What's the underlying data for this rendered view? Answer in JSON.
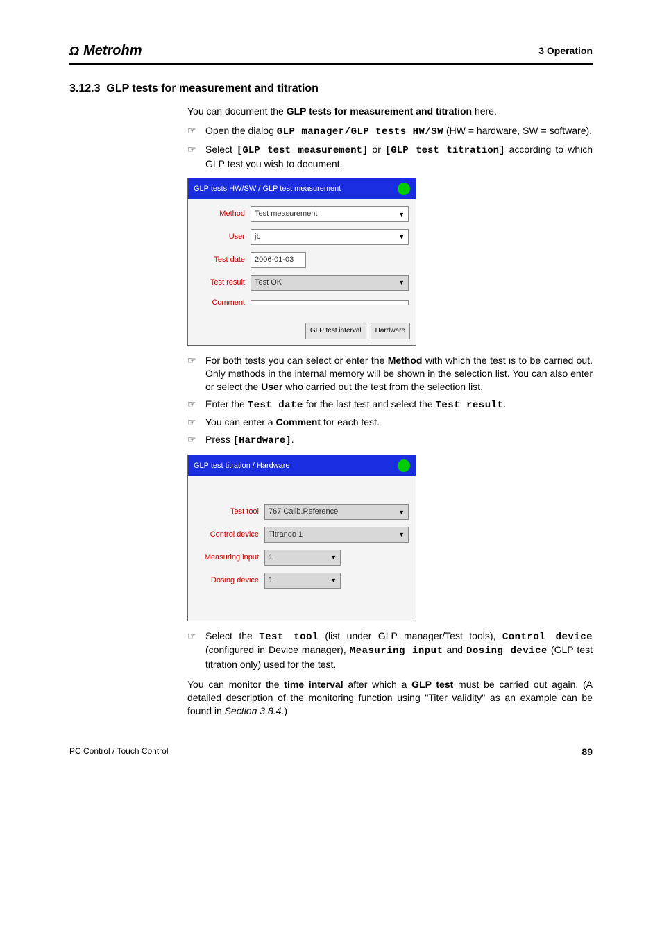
{
  "header": {
    "brand": "Metrohm",
    "brand_icon": "Ω",
    "chapter": "3 Operation"
  },
  "section": {
    "number": "3.12.3",
    "title": "GLP tests for measurement and titration"
  },
  "intro": {
    "line1_a": "You can document the ",
    "line1_b": "GLP tests for measurement and titration",
    "line1_c": " here."
  },
  "bullets1": {
    "b1_a": "Open the dialog ",
    "b1_b": "GLP manager/GLP tests HW/SW",
    "b1_c": " (HW = hardware, SW = software).",
    "b2_a": "Select ",
    "b2_b": "[GLP test measurement]",
    "b2_c": " or ",
    "b2_d": "[GLP test titration]",
    "b2_e": " according to which GLP test you wish to document."
  },
  "dialog1": {
    "title": "GLP tests HW/SW / GLP test measurement",
    "labels": {
      "method": "Method",
      "user": "User",
      "testdate": "Test date",
      "testresult": "Test result",
      "comment": "Comment"
    },
    "values": {
      "method": "Test measurement",
      "user": "jb",
      "testdate": "2006-01-03",
      "testresult": "Test OK",
      "comment": ""
    },
    "buttons": {
      "interval": "GLP test interval",
      "hardware": "Hardware"
    }
  },
  "bullets2": {
    "b1_a": "For both tests you can select or enter the ",
    "b1_b": "Method",
    "b1_c": " with which the test is to be carried out. Only methods in the internal memory will be shown in the selection list. You can also enter or select the ",
    "b1_d": "User",
    "b1_e": " who carried out the test from the selection list.",
    "b2_a": "Enter the ",
    "b2_b": "Test date",
    "b2_c": " for the last test and select the ",
    "b2_d": "Test result",
    "b2_e": ".",
    "b3_a": "You can enter a ",
    "b3_b": "Comment",
    "b3_c": " for each test.",
    "b4_a": "Press ",
    "b4_b": "[Hardware]",
    "b4_c": "."
  },
  "dialog2": {
    "title": "GLP test titration / Hardware",
    "labels": {
      "testtool": "Test tool",
      "controldevice": "Control device",
      "measinput": "Measuring input",
      "dosingdevice": "Dosing device"
    },
    "values": {
      "testtool": "767 Calib.Reference",
      "controldevice": "Titrando 1",
      "measinput": "1",
      "dosingdevice": "1"
    }
  },
  "bullets3": {
    "b1_a": "Select the ",
    "b1_b": "Test tool",
    "b1_c": " (list under GLP manager/Test tools), ",
    "b1_d": "Control device",
    "b1_e": " (configured in Device manager), ",
    "b1_f": "Measuring input",
    "b1_g": " and ",
    "b1_h": "Dosing device",
    "b1_i": " (GLP test titration only) used for the test."
  },
  "closing": {
    "a": "You can monitor the ",
    "b": "time interval",
    "c": " after which a ",
    "d": "GLP test",
    "e": " must be carried out again. (A detailed description of the monitoring function using \"Titer validity\" as an example can be found in ",
    "f": "Section 3.8.4.",
    "g": ")"
  },
  "footer": {
    "left": "PC Control / Touch Control",
    "page": "89"
  }
}
